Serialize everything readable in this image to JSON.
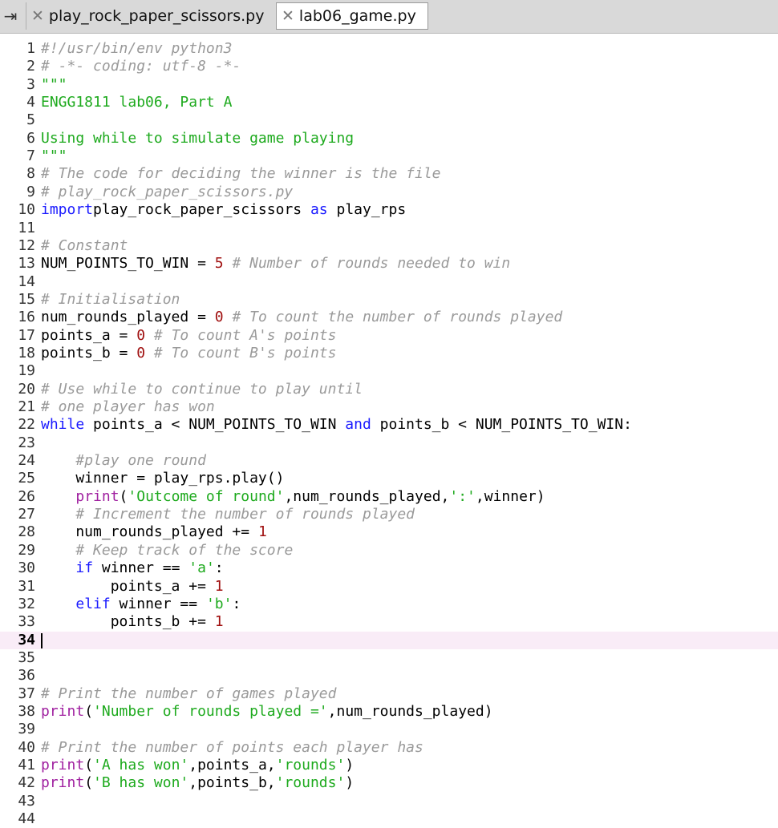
{
  "tabs": [
    {
      "label": "play_rock_paper_scissors.py",
      "active": false
    },
    {
      "label": "lab06_game.py",
      "active": true
    }
  ],
  "editor": {
    "current_line": 34,
    "lines": [
      {
        "n": "1",
        "t": [
          [
            "cmt",
            "#!/usr/bin/env python3"
          ]
        ]
      },
      {
        "n": "2",
        "t": [
          [
            "cmt",
            "# -*- coding: utf-8 -*-"
          ]
        ]
      },
      {
        "n": "3",
        "t": [
          [
            "str",
            "\"\"\""
          ]
        ]
      },
      {
        "n": "4",
        "t": [
          [
            "str",
            "ENGG1811 lab06, Part A"
          ]
        ]
      },
      {
        "n": "5",
        "t": []
      },
      {
        "n": "6",
        "t": [
          [
            "str",
            "Using while to simulate game playing"
          ]
        ]
      },
      {
        "n": "7",
        "t": [
          [
            "str",
            "\"\"\""
          ]
        ]
      },
      {
        "n": "8",
        "t": [
          [
            "cmt",
            "# The code for deciding the winner is the file"
          ]
        ]
      },
      {
        "n": "9",
        "t": [
          [
            "cmt",
            "# play_rock_paper_scissors.py"
          ]
        ]
      },
      {
        "n": "10",
        "t": [
          [
            "kw",
            "import"
          ],
          [
            "",
            "play_rock_paper_scissors "
          ],
          [
            "kw",
            "as"
          ],
          [
            "",
            " play_rps"
          ]
        ]
      },
      {
        "n": "11",
        "t": []
      },
      {
        "n": "12",
        "t": [
          [
            "cmt",
            "# Constant"
          ]
        ]
      },
      {
        "n": "13",
        "t": [
          [
            "",
            "NUM_POINTS_TO_WIN = "
          ],
          [
            "numlit",
            "5"
          ],
          [
            "",
            " "
          ],
          [
            "cmt",
            "# Number of rounds needed to win"
          ]
        ]
      },
      {
        "n": "14",
        "t": []
      },
      {
        "n": "15",
        "t": [
          [
            "cmt",
            "# Initialisation"
          ]
        ]
      },
      {
        "n": "16",
        "t": [
          [
            "",
            "num_rounds_played = "
          ],
          [
            "numlit",
            "0"
          ],
          [
            "",
            " "
          ],
          [
            "cmt",
            "# To count the number of rounds played"
          ]
        ]
      },
      {
        "n": "17",
        "t": [
          [
            "",
            "points_a = "
          ],
          [
            "numlit",
            "0"
          ],
          [
            "",
            " "
          ],
          [
            "cmt",
            "# To count A's points"
          ]
        ]
      },
      {
        "n": "18",
        "t": [
          [
            "",
            "points_b = "
          ],
          [
            "numlit",
            "0"
          ],
          [
            "",
            " "
          ],
          [
            "cmt",
            "# To count B's points"
          ]
        ]
      },
      {
        "n": "19",
        "t": []
      },
      {
        "n": "20",
        "t": [
          [
            "cmt",
            "# Use while to continue to play until"
          ]
        ]
      },
      {
        "n": "21",
        "t": [
          [
            "cmt",
            "# one player has won"
          ]
        ]
      },
      {
        "n": "22",
        "t": [
          [
            "kw",
            "while"
          ],
          [
            "",
            " points_a < NUM_POINTS_TO_WIN "
          ],
          [
            "kw",
            "and"
          ],
          [
            "",
            " points_b < NUM_POINTS_TO_WIN:"
          ]
        ]
      },
      {
        "n": "23",
        "t": []
      },
      {
        "n": "24",
        "t": [
          [
            "",
            "    "
          ],
          [
            "cmt",
            "#play one round"
          ]
        ]
      },
      {
        "n": "25",
        "t": [
          [
            "",
            "    winner = play_rps.play()"
          ]
        ]
      },
      {
        "n": "26",
        "t": [
          [
            "",
            "    "
          ],
          [
            "bi",
            "print"
          ],
          [
            "",
            "("
          ],
          [
            "str",
            "'Outcome of round'"
          ],
          [
            "",
            ",num_rounds_played,"
          ],
          [
            "str",
            "':'"
          ],
          [
            "",
            ",winner)"
          ]
        ]
      },
      {
        "n": "27",
        "t": [
          [
            "",
            "    "
          ],
          [
            "cmt",
            "# Increment the number of rounds played"
          ]
        ]
      },
      {
        "n": "28",
        "t": [
          [
            "",
            "    num_rounds_played += "
          ],
          [
            "numlit",
            "1"
          ]
        ]
      },
      {
        "n": "29",
        "t": [
          [
            "",
            "    "
          ],
          [
            "cmt",
            "# Keep track of the score"
          ]
        ]
      },
      {
        "n": "30",
        "t": [
          [
            "",
            "    "
          ],
          [
            "kw",
            "if"
          ],
          [
            "",
            " winner == "
          ],
          [
            "str",
            "'a'"
          ],
          [
            "",
            ":"
          ]
        ]
      },
      {
        "n": "31",
        "t": [
          [
            "",
            "        points_a += "
          ],
          [
            "numlit",
            "1"
          ]
        ]
      },
      {
        "n": "32",
        "t": [
          [
            "",
            "    "
          ],
          [
            "kw",
            "elif"
          ],
          [
            "",
            " winner == "
          ],
          [
            "str",
            "'b'"
          ],
          [
            "",
            ":"
          ]
        ]
      },
      {
        "n": "33",
        "t": [
          [
            "",
            "        points_b += "
          ],
          [
            "numlit",
            "1"
          ]
        ]
      },
      {
        "n": "34",
        "t": []
      },
      {
        "n": "35",
        "t": []
      },
      {
        "n": "36",
        "t": []
      },
      {
        "n": "37",
        "t": [
          [
            "cmt",
            "# Print the number of games played"
          ]
        ]
      },
      {
        "n": "38",
        "t": [
          [
            "bi",
            "print"
          ],
          [
            "",
            "("
          ],
          [
            "str",
            "'Number of rounds played ='"
          ],
          [
            "",
            ",num_rounds_played)"
          ]
        ]
      },
      {
        "n": "39",
        "t": []
      },
      {
        "n": "40",
        "t": [
          [
            "cmt",
            "# Print the number of points each player has"
          ]
        ]
      },
      {
        "n": "41",
        "t": [
          [
            "bi",
            "print"
          ],
          [
            "",
            "("
          ],
          [
            "str",
            "'A has won'"
          ],
          [
            "",
            ",points_a,"
          ],
          [
            "str",
            "'rounds'"
          ],
          [
            "",
            ")"
          ]
        ]
      },
      {
        "n": "42",
        "t": [
          [
            "bi",
            "print"
          ],
          [
            "",
            "("
          ],
          [
            "str",
            "'B has won'"
          ],
          [
            "",
            ",points_b,"
          ],
          [
            "str",
            "'rounds'"
          ],
          [
            "",
            ")"
          ]
        ]
      },
      {
        "n": "43",
        "t": []
      },
      {
        "n": "44",
        "t": []
      }
    ]
  }
}
